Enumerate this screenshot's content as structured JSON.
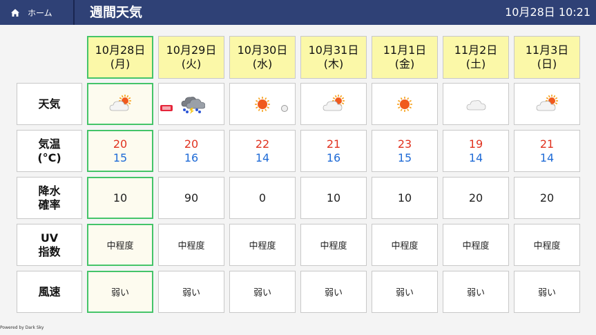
{
  "header": {
    "home_label": "ホーム",
    "title": "週間天気",
    "datetime": "10月28日 10:21"
  },
  "row_labels": {
    "weather": "天気",
    "temp_l1": "気温",
    "temp_l2": "(°C)",
    "rain_l1": "降水",
    "rain_l2": "確率",
    "uv_l1": "UV",
    "uv_l2": "指数",
    "wind": "風速"
  },
  "days": [
    {
      "date": "10月28日",
      "dow": "(月)",
      "icon": "partly-cloudy-icon",
      "high": "20",
      "low": "15",
      "rain": "10",
      "uv": "中程度",
      "wind": "弱い"
    },
    {
      "date": "10月29日",
      "dow": "(火)",
      "icon": "thunderstorm-rain-icon",
      "high": "20",
      "low": "16",
      "rain": "90",
      "uv": "中程度",
      "wind": "弱い"
    },
    {
      "date": "10月30日",
      "dow": "(水)",
      "icon": "sunny-icon",
      "high": "22",
      "low": "14",
      "rain": "0",
      "uv": "中程度",
      "wind": "弱い"
    },
    {
      "date": "10月31日",
      "dow": "(木)",
      "icon": "partly-cloudy-icon",
      "high": "21",
      "low": "16",
      "rain": "10",
      "uv": "中程度",
      "wind": "弱い"
    },
    {
      "date": "11月1日",
      "dow": "(金)",
      "icon": "sunny-icon",
      "high": "23",
      "low": "15",
      "rain": "10",
      "uv": "中程度",
      "wind": "弱い"
    },
    {
      "date": "11月2日",
      "dow": "(土)",
      "icon": "cloudy-icon",
      "high": "19",
      "low": "14",
      "rain": "20",
      "uv": "中程度",
      "wind": "弱い"
    },
    {
      "date": "11月3日",
      "dow": "(日)",
      "icon": "partly-cloudy-icon",
      "high": "21",
      "low": "14",
      "rain": "20",
      "uv": "中程度",
      "wind": "弱い"
    }
  ],
  "colors": {
    "header_bg": "#2f4176",
    "date_header_bg": "#fbf8a8",
    "today_border": "#44c469",
    "high_temp": "#e0321f",
    "low_temp": "#1f6bd6",
    "alert_badge": "#e5263b"
  },
  "footer": {
    "powered_by": "Powered by Dark Sky"
  }
}
